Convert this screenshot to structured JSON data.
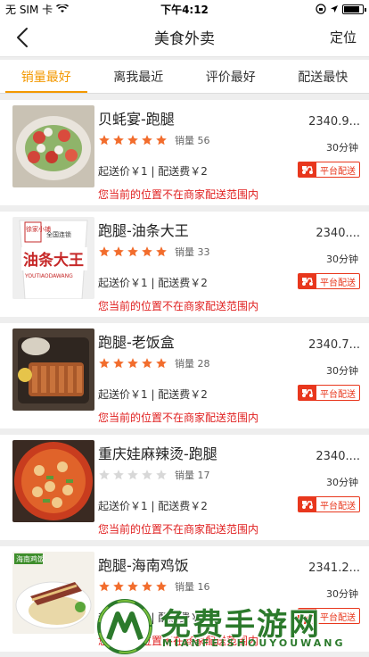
{
  "status_bar": {
    "carrier": "无 SIM 卡",
    "time": "下午4:12",
    "battery_level": 0.85
  },
  "nav": {
    "title": "美食外卖",
    "locate_label": "定位"
  },
  "tabs": [
    {
      "label": "销量最好",
      "active": true
    },
    {
      "label": "离我最近",
      "active": false
    },
    {
      "label": "评价最好",
      "active": false
    },
    {
      "label": "配送最快",
      "active": false
    }
  ],
  "shops": [
    {
      "name": "贝蚝宴-跑腿",
      "rating": 5,
      "sales": "销量 56",
      "distance": "2340.9...",
      "delivery_time": "30分钟",
      "price_info": "起送价￥1 | 配送费￥2",
      "badge": "平台配送",
      "notice": "您当前的位置不在商家配送范围内",
      "thumb": "salad"
    },
    {
      "name": "跑腿-油条大王",
      "rating": 5,
      "sales": "销量 33",
      "distance": "2340....",
      "delivery_time": "30分钟",
      "price_info": "起送价￥1 | 配送费￥2",
      "badge": "平台配送",
      "notice": "您当前的位置不在商家配送范围内",
      "thumb": "cup"
    },
    {
      "name": "跑腿-老饭盒",
      "rating": 5,
      "sales": "销量 28",
      "distance": "2340.7...",
      "delivery_time": "30分钟",
      "price_info": "起送价￥1 | 配送费￥2",
      "badge": "平台配送",
      "notice": "您当前的位置不在商家配送范围内",
      "thumb": "box"
    },
    {
      "name": "重庆娃麻辣烫-跑腿",
      "rating": 0,
      "sales": "销量 17",
      "distance": "2340....",
      "delivery_time": "30分钟",
      "price_info": "起送价￥1 | 配送费￥2",
      "badge": "平台配送",
      "notice": "您当前的位置不在商家配送范围内",
      "thumb": "bowl"
    },
    {
      "name": "跑腿-海南鸡饭",
      "rating": 5,
      "sales": "销量 16",
      "distance": "2341.2...",
      "delivery_time": "30分钟",
      "price_info": "起送价￥1 | 配送费￥2",
      "badge": "平台配送",
      "notice": "您当前的位置不在商家配送范围内",
      "thumb": "rice"
    }
  ],
  "thumb_texts": {
    "cup_brand": "徐家小铺",
    "cup_chain": "全国连锁",
    "cup_name": "油条大王",
    "cup_pinyin": "YOUTIAODAWANG",
    "rice_tag": "海南鸡饭"
  },
  "watermark": {
    "text": "免费手游网",
    "sub": "MIANFEISHOUYOUWANG"
  },
  "colors": {
    "accent": "#f39800",
    "star": "#f26d2d",
    "warning": "#e02020",
    "badge": "#e8371d"
  }
}
